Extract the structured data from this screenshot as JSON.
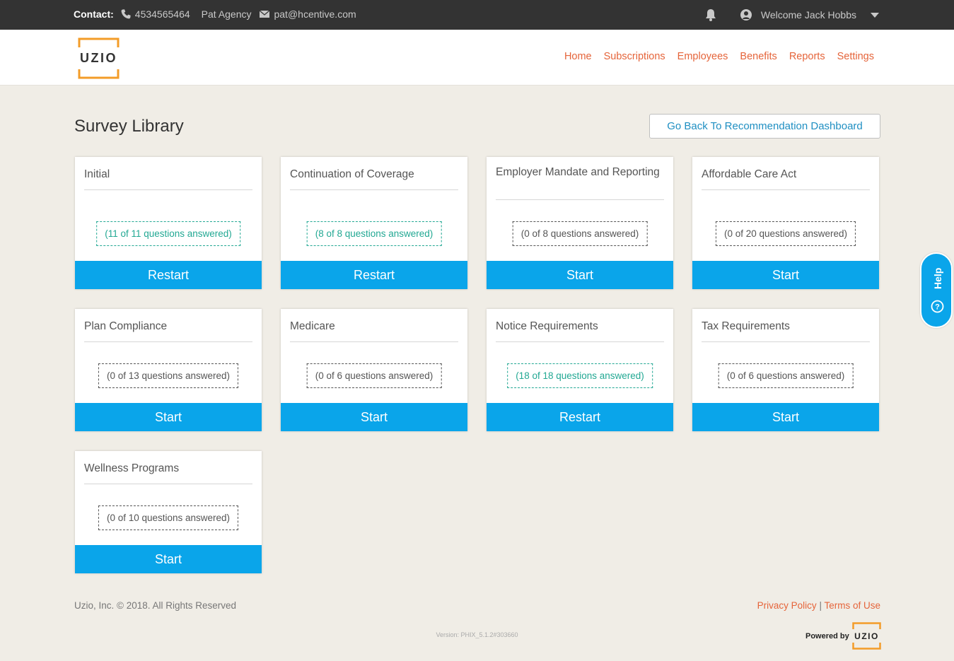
{
  "topbar": {
    "contact_label": "Contact:",
    "phone": "4534565464",
    "agency": "Pat Agency",
    "email": "pat@hcentive.com",
    "welcome": "Welcome Jack Hobbs"
  },
  "brand": {
    "logo_text": "UZIO",
    "accent": "#f39c28"
  },
  "nav": {
    "items": [
      {
        "label": "Home"
      },
      {
        "label": "Subscriptions"
      },
      {
        "label": "Employees"
      },
      {
        "label": "Benefits"
      },
      {
        "label": "Reports"
      },
      {
        "label": "Settings"
      }
    ]
  },
  "page": {
    "title": "Survey Library",
    "back_button": "Go Back To Recommendation Dashboard"
  },
  "cards": [
    {
      "title": "Initial",
      "status": "(11 of 11 questions answered)",
      "complete": true,
      "action": "Restart"
    },
    {
      "title": "Continuation of Coverage",
      "status": "(8 of 8 questions answered)",
      "complete": true,
      "action": "Restart"
    },
    {
      "title": "Employer Mandate and Reporting",
      "status": "(0 of 8 questions answered)",
      "complete": false,
      "action": "Start"
    },
    {
      "title": "Affordable Care Act",
      "status": "(0 of 20 questions answered)",
      "complete": false,
      "action": "Start"
    },
    {
      "title": "Plan Compliance",
      "status": "(0 of 13 questions answered)",
      "complete": false,
      "action": "Start"
    },
    {
      "title": "Medicare",
      "status": "(0 of 6 questions answered)",
      "complete": false,
      "action": "Start"
    },
    {
      "title": "Notice Requirements",
      "status": "(18 of 18 questions answered)",
      "complete": true,
      "action": "Restart"
    },
    {
      "title": "Tax Requirements",
      "status": "(0 of 6 questions answered)",
      "complete": false,
      "action": "Start"
    },
    {
      "title": "Wellness Programs",
      "status": "(0 of 10 questions answered)",
      "complete": false,
      "action": "Start"
    }
  ],
  "help": {
    "label": "Help"
  },
  "footer": {
    "copyright": "Uzio, Inc. © 2018. All Rights Reserved",
    "privacy": "Privacy Policy",
    "separator": "|",
    "terms": "Terms of Use",
    "version": "Version: PHIX_5.1.2#303660",
    "powered_by": "Powered by",
    "powered_logo": "UZIO"
  },
  "colors": {
    "topbar": "#333333",
    "nav_link": "#e5643a",
    "button_blue": "#0aa5ea",
    "complete_green": "#22a893",
    "background": "#f0ede6"
  }
}
